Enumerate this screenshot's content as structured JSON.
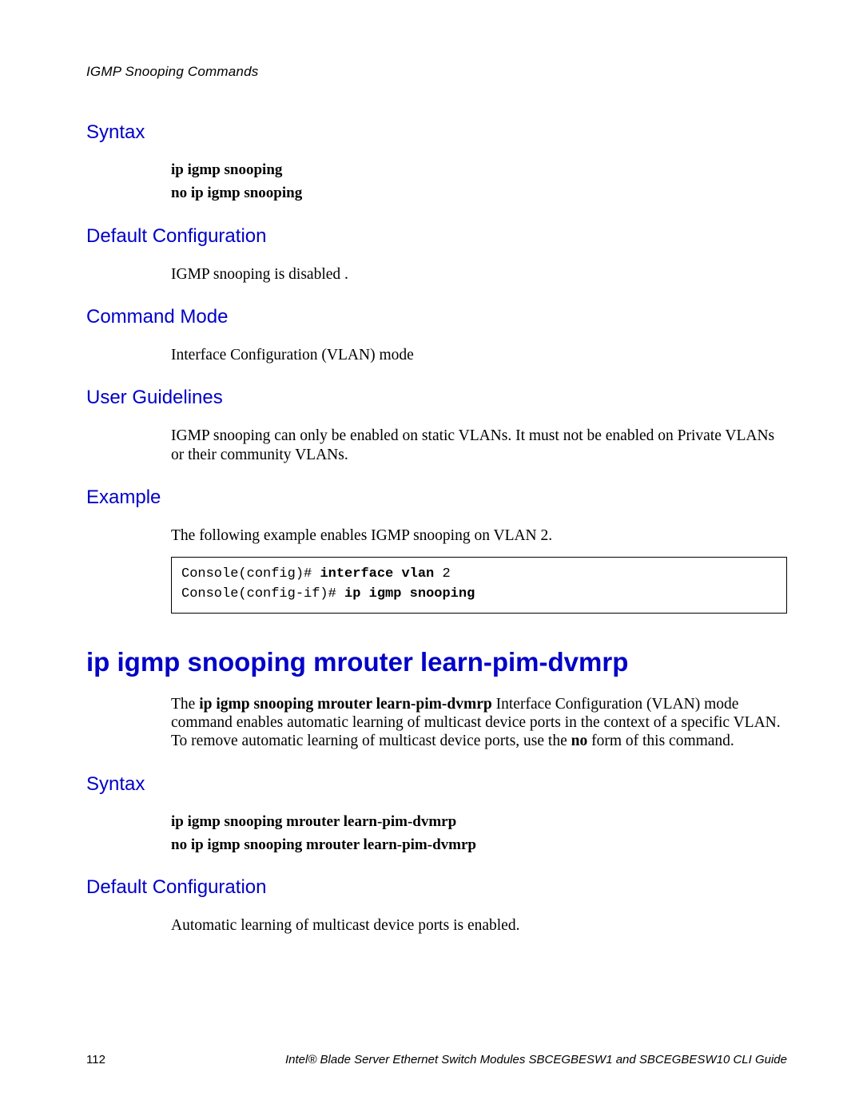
{
  "header": {
    "running_head": "IGMP Snooping Commands"
  },
  "sec1": {
    "syntax_h": "Syntax",
    "syntax1": "ip igmp snooping",
    "syntax2": "no ip igmp snooping",
    "defcfg_h": "Default Configuration",
    "defcfg_p": "IGMP snooping is disabled .",
    "cmdmode_h": "Command Mode",
    "cmdmode_p": "Interface Configuration (VLAN) mode",
    "ug_h": "User Guidelines",
    "ug_p": "IGMP snooping can only be enabled on static VLANs. It must not be enabled on Private VLANs or their community VLANs.",
    "ex_h": "Example",
    "ex_p": "The following example enables IGMP snooping on VLAN 2.",
    "code": {
      "l1a": "Console(config)# ",
      "l1b": "interface vlan ",
      "l1c": "2",
      "l2a": "Console(config-if)# ",
      "l2b": "ip igmp snooping"
    }
  },
  "sec2": {
    "title": "ip igmp snooping mrouter learn-pim-dvmrp",
    "desc_pre": "The ",
    "desc_cmd": "ip igmp snooping mrouter learn-pim-dvmrp",
    "desc_mid": " Interface Configuration (VLAN) mode command enables automatic learning of multicast device ports in the context of a specific VLAN. To remove automatic learning of multicast device ports, use the ",
    "desc_no": "no",
    "desc_post": " form of this command.",
    "syntax_h": "Syntax",
    "syntax1": "ip igmp snooping mrouter learn-pim-dvmrp",
    "syntax2": "no ip igmp snooping mrouter learn-pim-dvmrp",
    "defcfg_h": "Default Configuration",
    "defcfg_p": "Automatic learning of multicast device ports is enabled."
  },
  "footer": {
    "page": "112",
    "guide": "Intel® Blade Server Ethernet Switch Modules SBCEGBESW1 and SBCEGBESW10 CLI Guide"
  }
}
